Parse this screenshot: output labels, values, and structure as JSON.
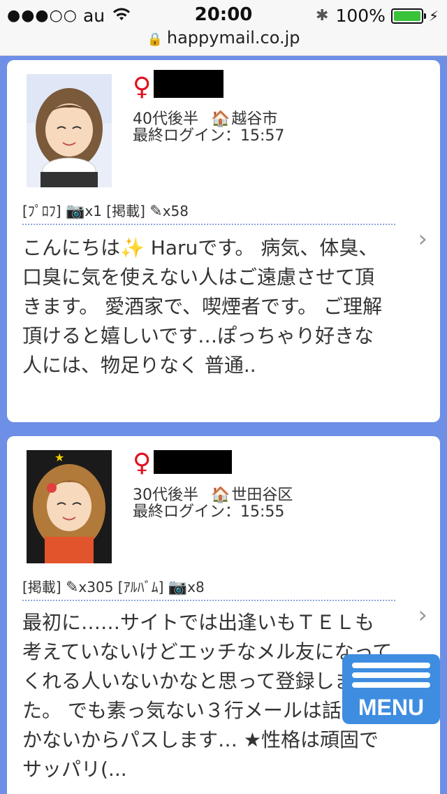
{
  "status_bar": {
    "signal": "●●●○○",
    "carrier": "au",
    "time": "20:00",
    "battery_text": "100%",
    "battery_level": 1.0
  },
  "browser": {
    "url": "happymail.co.jp"
  },
  "profiles": [
    {
      "gender_symbol": "♀",
      "age": "40代後半",
      "location": "越谷市",
      "last_login": "最終ログイン：15:57",
      "stats": [
        "[ﾌﾟﾛﾌ]",
        "x1",
        "[掲載]",
        "x58"
      ],
      "message": "こんにちは✨ Haruです。 病気、体臭、口臭に気を使えない人はご遠慮させて頂きます。 愛酒家で、喫煙者です。 ご理解頂けると嬉しいです…ぽっちゃり好きな人には、物足りなく 普通.."
    },
    {
      "gender_symbol": "♀",
      "age": "30代後半",
      "location": "世田谷区",
      "last_login": "最終ログイン：15:55",
      "stats": [
        "[掲載]",
        "x305",
        "[ｱﾙﾊﾞﾑ]",
        "x8"
      ],
      "message": "最初に……サイトでは出逢いもＴＥＬも考えていないけどエッチなメル友になってくれる人いないかなと思って登録しました。 でも素っ気ない３行メールは話が続かないからパスします… ★性格は頑固でサッパリ(..."
    }
  ],
  "menu": {
    "label": "MENU"
  }
}
